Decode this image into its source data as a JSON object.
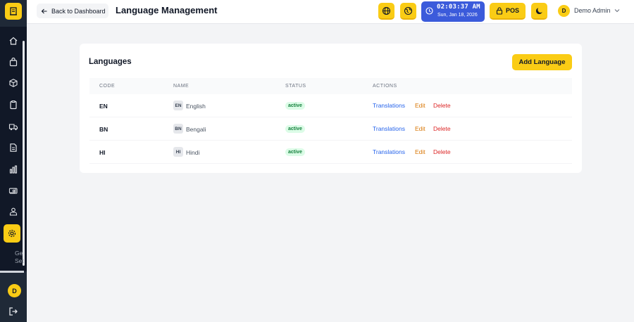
{
  "sidebar": {
    "items": [
      {
        "icon": "home-icon"
      },
      {
        "icon": "shopping-bag-icon"
      },
      {
        "icon": "box-icon"
      },
      {
        "icon": "clipboard-icon"
      },
      {
        "icon": "truck-icon"
      },
      {
        "icon": "document-icon"
      },
      {
        "icon": "bar-chart-icon"
      },
      {
        "icon": "wallet-icon"
      },
      {
        "icon": "users-icon"
      },
      {
        "icon": "gear-icon",
        "active": true
      }
    ],
    "active_label_line1": "Ge",
    "active_label_line2": "Set",
    "avatar_initial": "D"
  },
  "header": {
    "back_label": "Back to Dashboard",
    "title": "Language Management",
    "clock_time": "02:03:37 AM",
    "clock_date": "Sun, Jan 18, 2026",
    "pos_label": "POS",
    "user_initial": "D",
    "user_name": "Demo Admin"
  },
  "card": {
    "title": "Languages",
    "add_button": "Add Language",
    "columns": [
      "CODE",
      "NAME",
      "STATUS",
      "ACTIONS"
    ],
    "rows": [
      {
        "code": "EN",
        "name": "English",
        "status": "active"
      },
      {
        "code": "BN",
        "name": "Bengali",
        "status": "active"
      },
      {
        "code": "HI",
        "name": "Hindi",
        "status": "active"
      }
    ],
    "actions": {
      "translations": "Translations",
      "edit": "Edit",
      "delete": "Delete"
    }
  },
  "colors": {
    "accent": "#facc15",
    "sidebar": "#1f2937",
    "clock": "#3b5bdb",
    "link_blue": "#2563eb",
    "edit_orange": "#d97706",
    "delete_red": "#dc2626",
    "status_green": "#15803d"
  }
}
